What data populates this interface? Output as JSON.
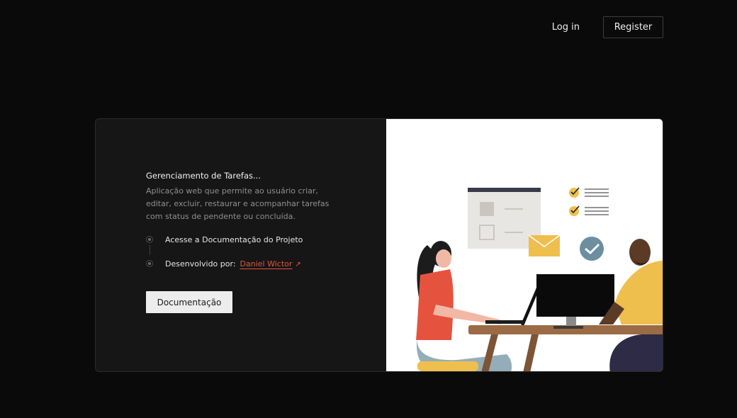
{
  "nav": {
    "login_label": "Log in",
    "register_label": "Register"
  },
  "card": {
    "title": "Gerenciamento de Tarefas...",
    "description": "Aplicação web que permite ao usuário criar, editar, excluir, restaurar e acompanhar tarefas com status de pendente ou concluída.",
    "steps": [
      {
        "label": "Acesse a Documentação do Projeto"
      },
      {
        "label": "Desenvolvido por:",
        "link_label": "Daniel Wictor",
        "link_icon": "external-link-icon"
      }
    ],
    "button_label": "Documentação"
  },
  "illustration": {
    "icons": [
      "task-window-icon",
      "checklist-icon",
      "envelope-icon",
      "check-circle-icon"
    ],
    "colors": {
      "accent": "#e5533f",
      "yellow": "#efbf4e",
      "slate": "#6b8ea0"
    }
  }
}
